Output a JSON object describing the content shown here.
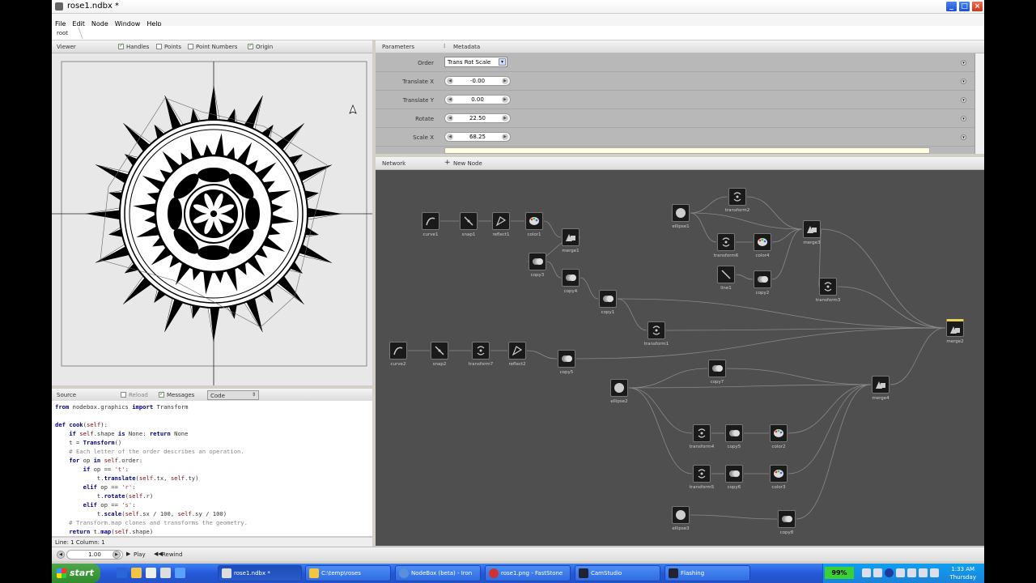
{
  "window": {
    "title": "rose1.ndbx *"
  },
  "menu": [
    "File",
    "Edit",
    "Node",
    "Window",
    "Help"
  ],
  "breadcrumb": "root",
  "viewer": {
    "title": "Viewer",
    "options": [
      {
        "label": "Handles",
        "checked": true
      },
      {
        "label": "Points",
        "checked": false
      },
      {
        "label": "Point Numbers",
        "checked": false
      },
      {
        "label": "Origin",
        "checked": true
      }
    ]
  },
  "parameters": {
    "tabs": [
      "Parameters",
      "Metadata"
    ],
    "rows": [
      {
        "label": "Order",
        "type": "select",
        "value": "Trans Rot Scale"
      },
      {
        "label": "Translate X",
        "type": "number",
        "value": "-0.00"
      },
      {
        "label": "Translate Y",
        "type": "number",
        "value": "0.00"
      },
      {
        "label": "Rotate",
        "type": "number",
        "value": "22.50"
      },
      {
        "label": "Scale X",
        "type": "number",
        "value": "68.25"
      }
    ]
  },
  "network": {
    "title": "Network",
    "new_node": "New Node",
    "nodes": [
      {
        "id": "curve1",
        "label": "curve1",
        "icon": "curve"
      },
      {
        "id": "snap1",
        "label": "snap1",
        "icon": "snap"
      },
      {
        "id": "reflect1",
        "label": "reflect1",
        "icon": "reflect"
      },
      {
        "id": "color1",
        "label": "color1",
        "icon": "color"
      },
      {
        "id": "merge1",
        "label": "merge1",
        "icon": "merge"
      },
      {
        "id": "copy3",
        "label": "copy3",
        "icon": "copy"
      },
      {
        "id": "copy4",
        "label": "copy4",
        "icon": "copy"
      },
      {
        "id": "copy1",
        "label": "copy1",
        "icon": "copy"
      },
      {
        "id": "transform1",
        "label": "transform1",
        "icon": "transform"
      },
      {
        "id": "ellipse1",
        "label": "ellipse1",
        "icon": "ellipse"
      },
      {
        "id": "transform2",
        "label": "transform2",
        "icon": "transform"
      },
      {
        "id": "transform6",
        "label": "transform6",
        "icon": "transform"
      },
      {
        "id": "color4",
        "label": "color4",
        "icon": "color"
      },
      {
        "id": "line1",
        "label": "line1",
        "icon": "line"
      },
      {
        "id": "copy2",
        "label": "copy2",
        "icon": "copy"
      },
      {
        "id": "merge3",
        "label": "merge3",
        "icon": "merge"
      },
      {
        "id": "transform3",
        "label": "transform3",
        "icon": "transform"
      },
      {
        "id": "merge2",
        "label": "merge2",
        "icon": "merge"
      },
      {
        "id": "curve2",
        "label": "curve2",
        "icon": "curve"
      },
      {
        "id": "snap2",
        "label": "snap2",
        "icon": "snap"
      },
      {
        "id": "transform7",
        "label": "transform7",
        "icon": "transform"
      },
      {
        "id": "reflect2",
        "label": "reflect2",
        "icon": "reflect"
      },
      {
        "id": "copy5",
        "label": "copy5",
        "icon": "copy"
      },
      {
        "id": "ellipse2",
        "label": "ellipse2",
        "icon": "ellipse"
      },
      {
        "id": "copy7",
        "label": "copy7",
        "icon": "copy"
      },
      {
        "id": "merge4",
        "label": "merge4",
        "icon": "merge"
      },
      {
        "id": "transform4",
        "label": "transform4",
        "icon": "transform"
      },
      {
        "id": "copy5b",
        "label": "copy5",
        "icon": "copy"
      },
      {
        "id": "color2",
        "label": "color2",
        "icon": "color"
      },
      {
        "id": "transform5",
        "label": "transform5",
        "icon": "transform"
      },
      {
        "id": "copy6",
        "label": "copy6",
        "icon": "copy"
      },
      {
        "id": "color3",
        "label": "color3",
        "icon": "color"
      },
      {
        "id": "ellipse3",
        "label": "ellipse3",
        "icon": "ellipse"
      },
      {
        "id": "copy8",
        "label": "copy8",
        "icon": "copy"
      }
    ]
  },
  "source": {
    "title": "Source",
    "reload": "Reload",
    "messages": "Messages",
    "mode": "Code",
    "lines": [
      "from nodebox.graphics import Transform",
      "",
      "def cook(self):",
      "    if self.shape is None: return None",
      "    t = Transform()",
      "    # Each letter of the order describes an operation.",
      "    for op in self.order:",
      "        if op == 't':",
      "            t.translate(self.tx, self.ty)",
      "        elif op == 'r':",
      "            t.rotate(self.r)",
      "        elif op == 's':",
      "            t.scale(self.sx / 100, self.sy / 100)",
      "    # Transform.map clones and transforms the geometry.",
      "    return t.map(self.shape)"
    ],
    "status": "Line:  1 Column:  1"
  },
  "playback": {
    "frame": "1.00",
    "play": "Play",
    "rewind": "Rewind"
  },
  "taskbar": {
    "start": "start",
    "items": [
      "rose1.ndbx *",
      "C:\\temp\\roses",
      "NodeBox (beta) - Iron",
      "rose1.png - FastStone",
      "CamStudio",
      "Flashing"
    ],
    "battery": "99%",
    "time": "1:33 AM",
    "day": "Thursday"
  },
  "colors": {
    "network_bg": "#4f4f4f",
    "params_bg": "#b8b8b8",
    "taskbar": "#2558d8",
    "start": "#3a9a36"
  }
}
